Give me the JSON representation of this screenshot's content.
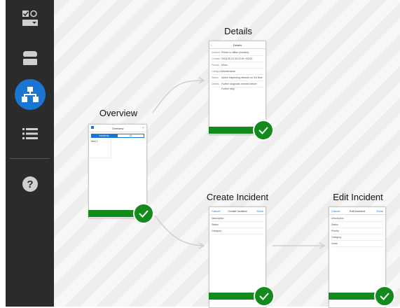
{
  "sidebar": {
    "items": [
      {
        "icon": "checkbox-radio-icon"
      },
      {
        "icon": "database-icon"
      },
      {
        "icon": "sitemap-icon",
        "active": true
      },
      {
        "icon": "list-icon"
      },
      {
        "icon": "help-icon"
      }
    ],
    "active_color": "#1976d2"
  },
  "screens": {
    "overview": {
      "title": "Overview",
      "header": "Overview",
      "tabs": [
        "Incidents",
        "All"
      ],
      "list_item": "Item 1"
    },
    "details": {
      "title": "Details",
      "header": "Details",
      "rows": [
        {
          "k": "Incident",
          "v": "Printer is offline (incident)"
        },
        {
          "k": "Created",
          "v": "2018-05-10 09:22:45 +00:00"
        },
        {
          "k": "Priority",
          "v": "Minor"
        },
        {
          "k": "Category",
          "v": "Maintenance"
        },
        {
          "k": "Status",
          "v": "Admin inspecting network on 3rd floor"
        },
        {
          "k": "Details",
          "v": "Further diagnosis needed before"
        }
      ],
      "row_extra": "Further step"
    },
    "create": {
      "title": "Create Incident",
      "header": "Create Incident",
      "left_link": "Cancel",
      "right_link": "Done",
      "fields": [
        "Description",
        "Status",
        "Category"
      ]
    },
    "edit": {
      "title": "Edit Incident",
      "header": "Edit Incident",
      "left_link": "Cancel",
      "right_link": "Done",
      "fields": [
        "Description",
        "Status",
        "Priority",
        "Category",
        "Notes"
      ]
    }
  },
  "colors": {
    "success": "#138a1c",
    "sidebar_bg": "#2b2b2b"
  }
}
